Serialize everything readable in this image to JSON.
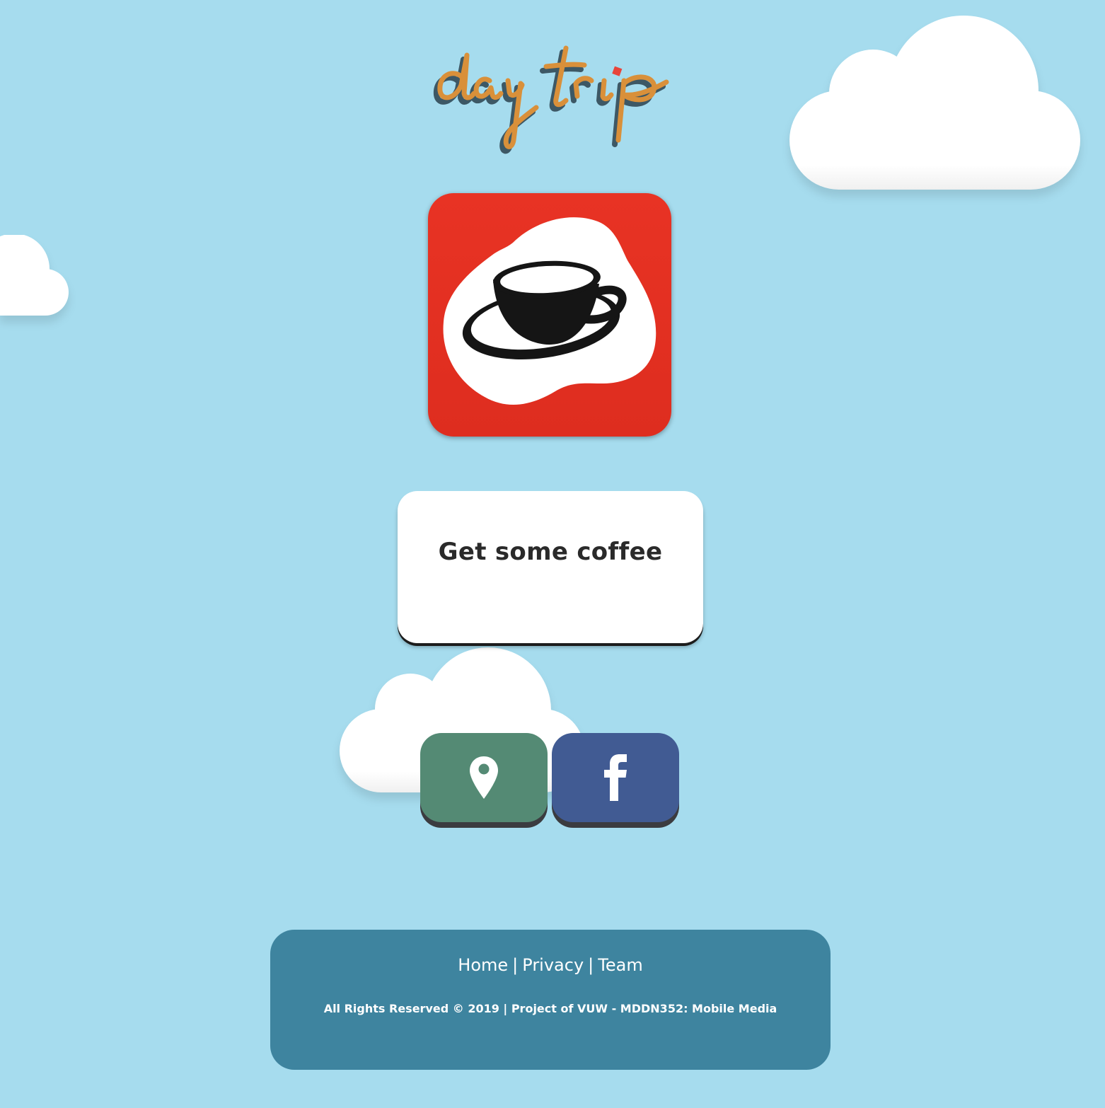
{
  "brand": {
    "logo_text": "day trip",
    "logo_color": "#d9903a",
    "logo_shadow_color": "#3d5865"
  },
  "colors": {
    "sky": "#a6dcee",
    "cloud": "#ffffff",
    "icon_bg": "#e83324",
    "location_button": "#548a74",
    "facebook_button": "#415b93",
    "footer_bg": "#3e849f"
  },
  "hero": {
    "icon": "coffee-cup-icon"
  },
  "cta": {
    "label": "Get some coffee"
  },
  "social": {
    "location_icon": "map-pin-icon",
    "facebook_icon": "facebook-icon",
    "facebook_glyph": "f"
  },
  "footer": {
    "links": {
      "home": "Home",
      "privacy": "Privacy",
      "team": "Team"
    },
    "separator": "|",
    "copyright": "All Rights Reserved © 2019 | Project of VUW - MDDN352: Mobile Media"
  }
}
